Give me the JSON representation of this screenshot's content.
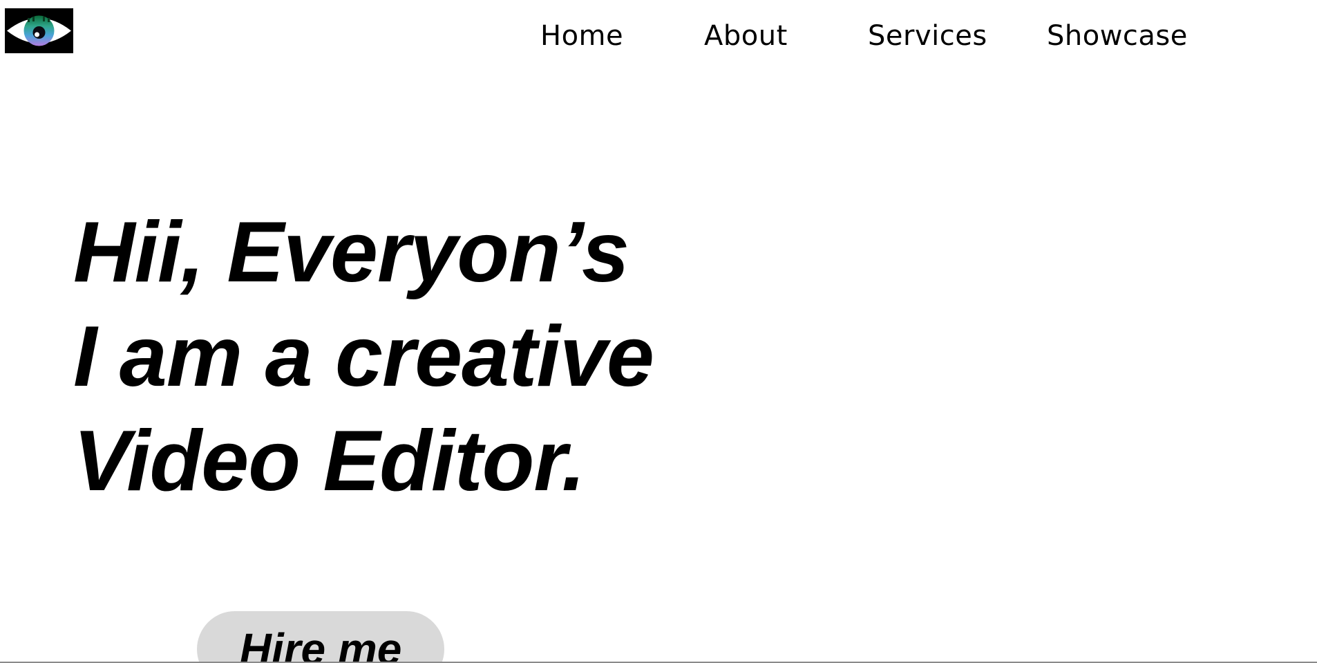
{
  "header": {
    "logo_icon": "eye-logo-icon",
    "nav": {
      "home": "Home",
      "about": "About",
      "services": "Services",
      "showcase": "Showcase"
    }
  },
  "hero": {
    "line1": "Hii, Everyon’s",
    "line2": "I am a creative",
    "line3": "Video Editor.",
    "hire_button": "Hire me"
  },
  "colors": {
    "background": "#ffffff",
    "text": "#000000",
    "button_bg": "#d9d9d9",
    "logo_bg": "#000000",
    "logo_iris": "#2fa58a"
  }
}
